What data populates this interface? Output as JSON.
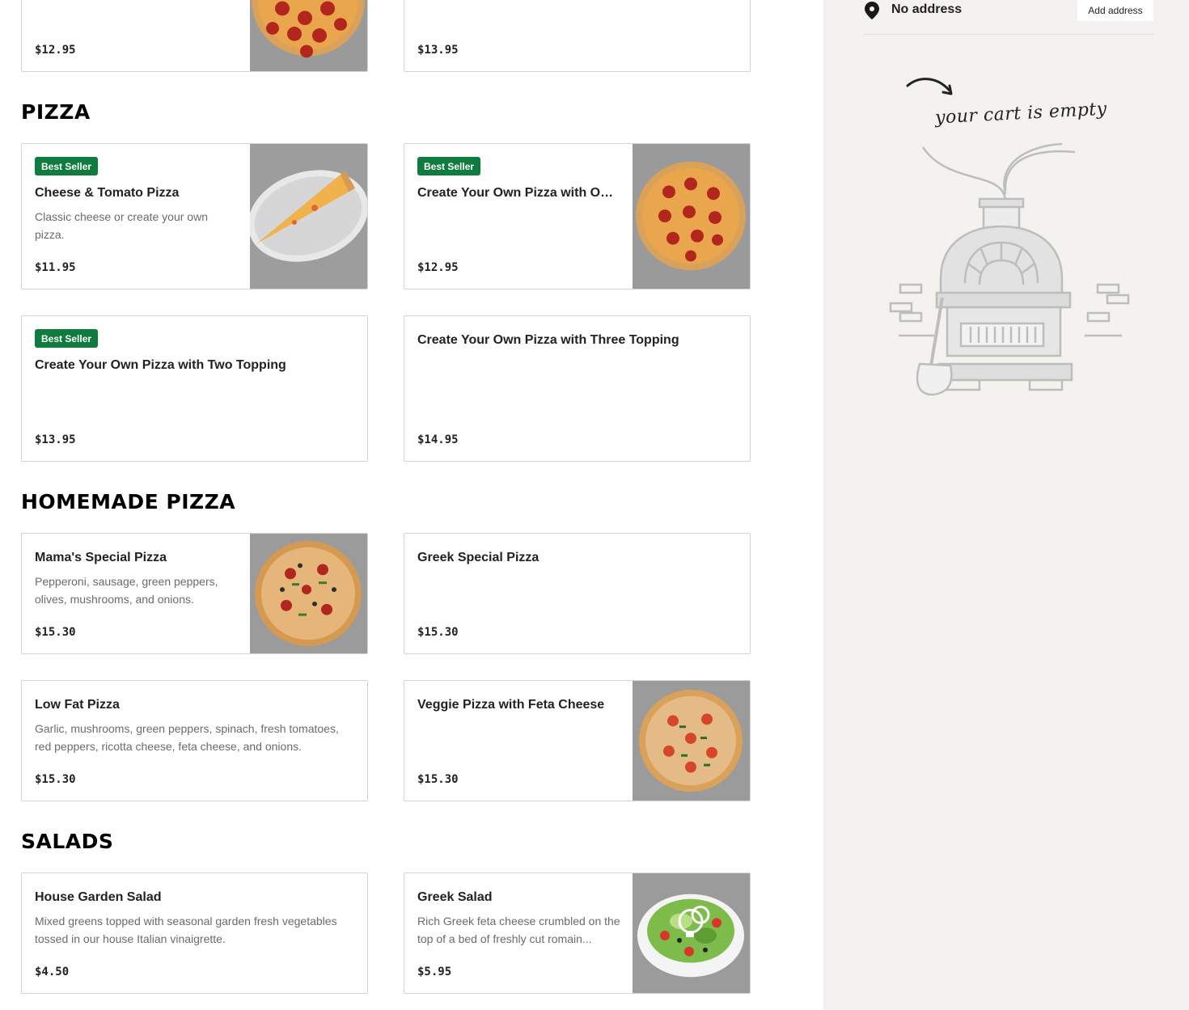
{
  "menu": {
    "sections": [
      {
        "title": ""
      },
      {
        "title": "PIZZA"
      },
      {
        "title": "HOMEMADE PIZZA"
      },
      {
        "title": "SALADS"
      }
    ],
    "items": [
      {
        "name": "",
        "description": "",
        "price": "$12.95",
        "badge": "",
        "image": "pepperoni-pizza-photo"
      },
      {
        "name": "",
        "description": "",
        "price": "$13.95",
        "badge": "",
        "image": ""
      },
      {
        "name": "Cheese & Tomato Pizza",
        "description": "Classic cheese or create your own pizza.",
        "price": "$11.95",
        "badge": "Best Seller",
        "image": "pizza-slice-photo"
      },
      {
        "name": "Create Your Own Pizza with One...",
        "description": "",
        "price": "$12.95",
        "badge": "Best Seller",
        "image": "pepperoni-pizza-photo"
      },
      {
        "name": "Create Your Own Pizza with Two Topping",
        "description": "",
        "price": "$13.95",
        "badge": "Best Seller",
        "image": ""
      },
      {
        "name": "Create Your Own Pizza with Three Topping",
        "description": "",
        "price": "$14.95",
        "badge": "",
        "image": ""
      },
      {
        "name": "Mama's Special Pizza",
        "description": "Pepperoni, sausage, green peppers, olives, mushrooms, and onions.",
        "price": "$15.30",
        "badge": "",
        "image": "supreme-pizza-photo"
      },
      {
        "name": "Greek Special Pizza",
        "description": "",
        "price": "$15.30",
        "badge": "",
        "image": ""
      },
      {
        "name": "Low Fat Pizza",
        "description": "Garlic, mushrooms, green peppers, spinach, fresh tomatoes, red peppers, ricotta cheese, feta cheese, and onions.",
        "price": "$15.30",
        "badge": "",
        "image": ""
      },
      {
        "name": "Veggie Pizza with Feta Cheese",
        "description": "",
        "price": "$15.30",
        "badge": "",
        "image": "veggie-pizza-photo"
      },
      {
        "name": "House Garden Salad",
        "description": "Mixed greens topped with seasonal garden fresh vegetables tossed in our house Italian vinaigrette.",
        "price": "$4.50",
        "badge": "",
        "image": ""
      },
      {
        "name": "Greek Salad",
        "description": "Rich Greek feta cheese crumbled on the top of a bed of freshly cut romain...",
        "price": "$5.95",
        "badge": "",
        "image": "salad-photo"
      }
    ]
  },
  "sidebar": {
    "address": "No address",
    "add_address_label": "Add address",
    "pin_icon": "location-pin-icon",
    "empty_cart_text": "your cart is empty",
    "illustration": "pizza-oven-illustration"
  },
  "colors": {
    "badge": "#0f7b3f",
    "sidebar_bg": "#f3f2ef",
    "card_border": "#d4d4d4"
  }
}
